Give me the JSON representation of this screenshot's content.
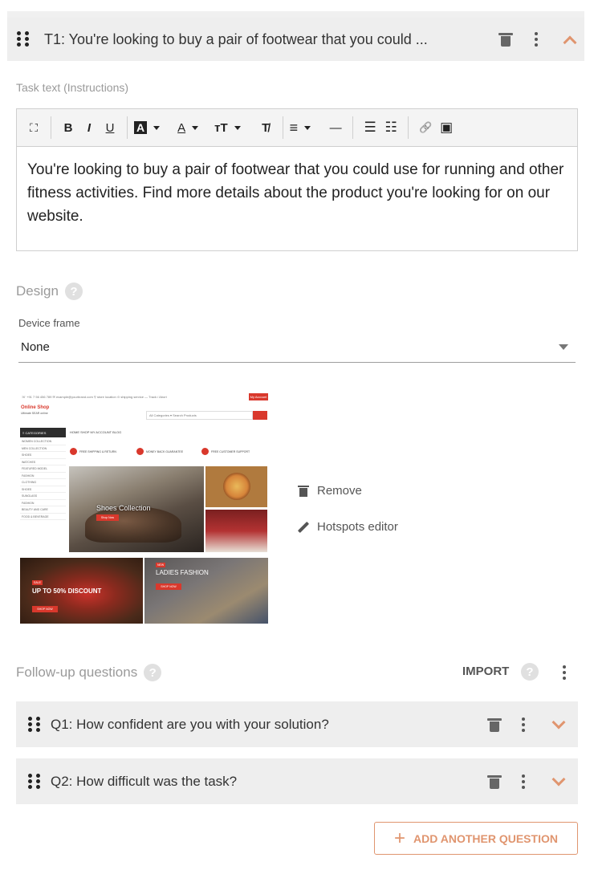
{
  "task": {
    "title": "T1: You're looking to buy a pair of footwear that you could ...",
    "instructions_label": "Task text (Instructions)",
    "instructions_text": "You're looking to buy a pair of footwear that you could use for running and other fitness activities. Find more details about the product you're looking for on our website."
  },
  "toolbar": {
    "fullscreen": "⛶",
    "bold": "B",
    "italic": "I",
    "underline": "U",
    "bg_color": "A",
    "font_color": "A",
    "font_size": "тT",
    "clear_format": "T̸",
    "align": "≡",
    "hr": "—",
    "ul": "☰",
    "ol": "☷",
    "link": "🔗",
    "image": "▣"
  },
  "design": {
    "title": "Design",
    "help": "?",
    "device_frame_label": "Device frame",
    "device_frame_value": "None"
  },
  "preview": {
    "top_bar": "☏ +91 7 56 456 789   ✉ example@yourbrand.com   ⚲ store location   ⊙ shipping service — Track / Abort",
    "header_button": "My Account",
    "logo": "Online Shop",
    "logo_sub": "Ultimate SEAR online",
    "search_placeholder": "All Categories  ▾   Search Products",
    "categories_label": "≡ CATEGORIES",
    "nav": "HOME  SHOP  MY ACCOUNT  BLOG",
    "category_items": [
      "WOMEN COLLECTION",
      "MEN COLLECTION",
      "SHOES",
      "WATCHES",
      "FEATURED MODEL",
      "FASHION",
      "CLOTHING",
      "SHOES",
      "SUNGLASS",
      "FASHION",
      "BEAUTY AND CARE",
      "FOOD & BEVERAGE"
    ],
    "features": [
      "FREE SHIPPING & RETURN",
      "MONEY BACK GUARANTEE",
      "FREE CUSTOMER SUPPORT"
    ],
    "banner_title": "Shoes Collection",
    "banner_button": "Shop Now",
    "sale_badge": "SALE",
    "sale_text": "UP TO 50% DISCOUNT",
    "sale_button": "SHOP NOW",
    "ladies_badge": "NEW",
    "ladies_text": "LADIES FASHION",
    "ladies_button": "SHOP NOW"
  },
  "image_actions": {
    "remove": "Remove",
    "hotspots": "Hotspots editor"
  },
  "followup": {
    "title": "Follow-up questions",
    "help": "?",
    "import": "IMPORT",
    "questions": [
      {
        "title": "Q1: How confident are you with your solution?"
      },
      {
        "title": "Q2: How difficult was the task?"
      }
    ],
    "add_button": "ADD ANOTHER QUESTION"
  },
  "colors": {
    "accent": "#e0956f",
    "header_bg": "#eeeeee",
    "muted_text": "#9a9a9a",
    "brand_red": "#d9382c"
  }
}
